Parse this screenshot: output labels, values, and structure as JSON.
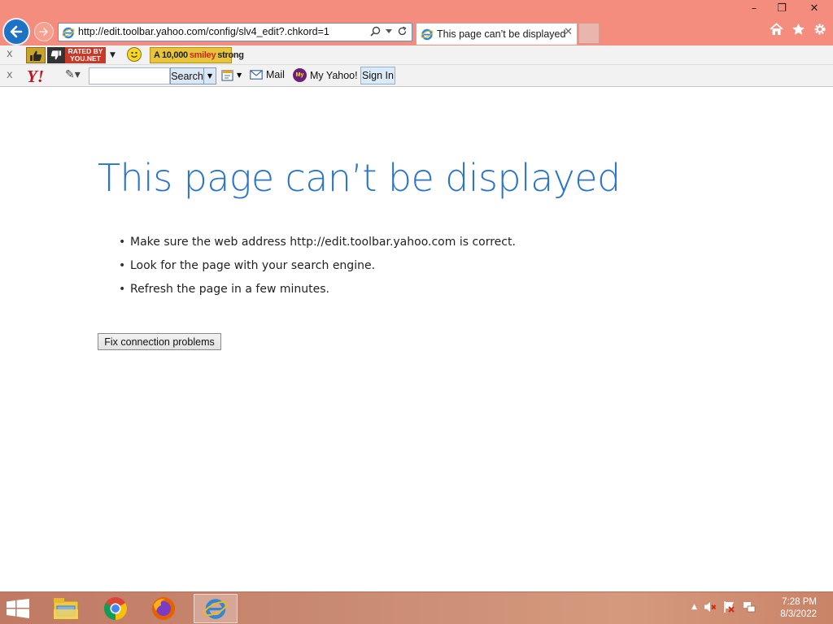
{
  "browser": {
    "address": "http://edit.toolbar.yahoo.com/config/slv4_edit?.chkord=1",
    "tab_title": "This page can’t be displayed",
    "tab_close": "✕",
    "window_controls": {
      "minimize": "–",
      "restore": "❐",
      "close": "✕"
    }
  },
  "toolbar1": {
    "close": "x",
    "rated_badge": [
      "RATED BY",
      "YOU.NET"
    ],
    "smiley_banner": {
      "prefix": "A 10,000",
      "highlight": "smiley",
      "suffix": "strong"
    }
  },
  "toolbar2": {
    "close": "x",
    "logo": "Y!",
    "search_input": "",
    "search_button": "Search",
    "mail": "Mail",
    "my_yahoo_icon": "My",
    "my_yahoo": "My Yahoo!",
    "sign_in": "Sign In"
  },
  "page": {
    "heading": "This page can’t be displayed",
    "bullets": [
      "Make sure the web address http://edit.toolbar.yahoo.com is correct.",
      "Look for the page with your search engine.",
      "Refresh the page in a few minutes."
    ],
    "fix_button": "Fix connection problems"
  },
  "taskbar": {
    "time": "7:28 PM",
    "date": "8/3/2022"
  },
  "colors": {
    "title_bar": "#f48d7e",
    "heading_blue": "#2b74c9",
    "back_button": "#1e72c4",
    "yahoo_red": "#c4101c"
  },
  "icons": [
    "back-arrow-icon",
    "forward-arrow-icon",
    "ie-icon",
    "search-icon",
    "refresh-icon",
    "home-icon",
    "star-icon",
    "gear-icon",
    "thumbs-up-icon",
    "thumbs-down-icon",
    "smiley-icon",
    "pen-icon",
    "calendar-icon",
    "mail-icon",
    "windows-logo-icon",
    "file-explorer-icon",
    "chrome-icon",
    "firefox-icon",
    "speaker-muted-icon",
    "flag-icon",
    "network-icon"
  ]
}
